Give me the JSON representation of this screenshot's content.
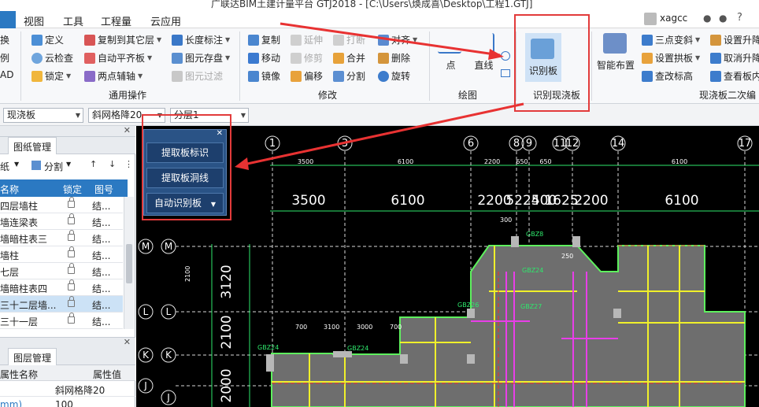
{
  "title_bar": {
    "text": "广联达BIM土建计量平台 GTJ2018 - [C:\\Users\\焕成喜\\Desktop\\工程1.GTJ]"
  },
  "menu": {
    "items": [
      "视图",
      "工具",
      "工程量",
      "云应用"
    ],
    "user": "xagcc"
  },
  "ribbon": {
    "general": {
      "items": [
        {
          "label": "换",
          "icon": "replace-icon"
        },
        {
          "label": "例",
          "icon": "table-icon"
        },
        {
          "label": "AD",
          "icon": "cad-icon"
        },
        {
          "label": "定义",
          "icon": "define-icon"
        },
        {
          "label": "云检查",
          "icon": "cloud-check-icon"
        },
        {
          "label": "锁定",
          "icon": "lock-icon"
        },
        {
          "label": "复制到其它层",
          "icon": "copy-layer-icon"
        },
        {
          "label": "自动平齐板",
          "icon": "align-slab-icon"
        },
        {
          "label": "两点辅轴",
          "icon": "two-point-axis-icon"
        },
        {
          "label": "长度标注",
          "icon": "length-dim-icon"
        },
        {
          "label": "图元存盘",
          "icon": "save-element-icon"
        },
        {
          "label": "图元过滤",
          "icon": "filter-icon"
        }
      ],
      "group_label": "通用操作"
    },
    "modify": {
      "items": [
        {
          "label": "复制",
          "icon": "copy-icon"
        },
        {
          "label": "延伸",
          "icon": "extend-icon"
        },
        {
          "label": "打断",
          "icon": "break-icon"
        },
        {
          "label": "对齐",
          "icon": "align-icon"
        },
        {
          "label": "移动",
          "icon": "move-icon"
        },
        {
          "label": "修剪",
          "icon": "trim-icon"
        },
        {
          "label": "合并",
          "icon": "merge-icon"
        },
        {
          "label": "删除",
          "icon": "delete-icon"
        },
        {
          "label": "镜像",
          "icon": "mirror-icon"
        },
        {
          "label": "偏移",
          "icon": "offset-icon"
        },
        {
          "label": "分割",
          "icon": "split-icon"
        },
        {
          "label": "旋转",
          "icon": "rotate-icon"
        }
      ],
      "group_label": "修改"
    },
    "draw": {
      "point_label": "点",
      "line_label": "直线",
      "group_label": "绘图"
    },
    "recognize": {
      "button_label": "识别板",
      "group_label": "识别现浇板"
    },
    "secondary": {
      "smart_layout": "智能布置",
      "items": [
        {
          "label": "三点变斜",
          "icon": "three-point-slope-icon"
        },
        {
          "label": "设置拱板",
          "icon": "arch-slab-icon"
        },
        {
          "label": "查改标高",
          "icon": "elevation-icon"
        },
        {
          "label": "设置升降",
          "icon": "lift-icon"
        },
        {
          "label": "取消升降",
          "icon": "cancel-lift-icon"
        },
        {
          "label": "查看板内",
          "icon": "view-slab-icon"
        }
      ],
      "group_label": "现浇板二次编"
    }
  },
  "combo_bar": {
    "component_type": "现浇板",
    "component_name": "斜网格降20",
    "layer": "分层1"
  },
  "left_panel": {
    "tabs": [
      "图纸管理"
    ],
    "toolbar": {
      "paper": "纸",
      "split": "分割"
    },
    "columns": [
      "名称",
      "锁定",
      "图号"
    ],
    "rows": [
      {
        "name": "四层墙柱",
        "num": "结..."
      },
      {
        "name": "墙连梁表",
        "num": "结..."
      },
      {
        "name": "墙暗柱表三",
        "num": "结..."
      },
      {
        "name": "墙柱",
        "num": "结..."
      },
      {
        "name": "七层",
        "num": "结..."
      },
      {
        "name": "墙暗柱表四",
        "num": "结..."
      },
      {
        "name": "三十二层墙...",
        "num": "结..."
      },
      {
        "name": "三十一层",
        "num": "结..."
      }
    ],
    "layer_tab": "图层管理",
    "props": {
      "col_name": "属性名称",
      "col_value": "属性值",
      "rows": [
        {
          "name": "",
          "value": "斜网格降20"
        },
        {
          "name": "mm)",
          "value": "100"
        }
      ]
    }
  },
  "float_panel": {
    "btn1": "提取板标识",
    "btn2": "提取板洞线",
    "btn3": "自动识别板"
  },
  "cad": {
    "axes_top": [
      "1",
      "3",
      "6",
      "8",
      "9",
      "11",
      "12",
      "14",
      "17"
    ],
    "dims_big": [
      "3500",
      "6100",
      "2200",
      "5225",
      "400",
      "1625",
      "2200",
      "6100"
    ],
    "dims_small": [
      "3500",
      "6100",
      "2200",
      "650",
      "650",
      "6100"
    ],
    "axes_left": [
      "M",
      "L",
      "K",
      "J"
    ],
    "vdims": [
      "3120",
      "2100",
      "2000"
    ],
    "labels": [
      "GBZ8",
      "GBZ24",
      "GBZ27",
      "GBZ26",
      "GBZ24",
      "GBZ24"
    ],
    "small_dims": [
      "300",
      "250",
      "2100",
      "700",
      "3100",
      "3000",
      "700"
    ]
  }
}
